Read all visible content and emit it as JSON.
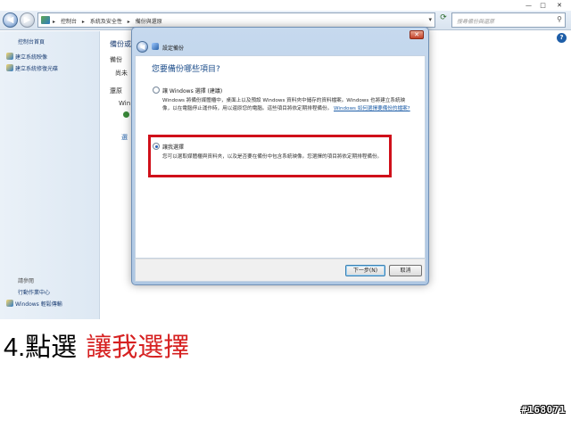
{
  "explorer": {
    "breadcrumbs": [
      "控制台",
      "系統及安全性",
      "備份與還原"
    ],
    "search_placeholder": "搜尋備份與還原",
    "window_controls": {
      "minimize": "—",
      "maximize": "□",
      "close": "✕"
    },
    "help_label": "?"
  },
  "sidebar": {
    "home": "控制台首頁",
    "items": [
      {
        "label": "建立系統映像",
        "icon": "shield-icon"
      },
      {
        "label": "建立系統修復光碟",
        "icon": "shield-icon"
      }
    ],
    "see_also": "請參閱",
    "bottom_items": [
      {
        "label": "行動作業中心"
      },
      {
        "label": "Windows 輕鬆傳輸",
        "icon": "transfer-icon"
      }
    ]
  },
  "background_main": {
    "title_fragment": "備份或",
    "label1": "備份",
    "label2": "尚未",
    "restore_label": "還原",
    "win_fragment": "Win",
    "link_fragment": "選"
  },
  "dialog": {
    "caption": "設定備份",
    "question": "您要備份哪些項目?",
    "option1": {
      "label": "讓 Windows 選擇 (建議)",
      "desc": "Windows 將備份媒體櫃中，桌面上以及預設 Windows 資料夾中儲存的資料檔案。Windows 也將建立系統映像，以在電腦停止運作時，用以還原您的電腦。這些項目將依定期排程備份。",
      "link": "Windows 如何選擇要備份的檔案?",
      "selected": false
    },
    "option2": {
      "label": "讓我選擇",
      "desc": "您可以選取媒體櫃與資料夾，以及是否要在備份中包含系統映像。您選擇的項目將依定期排程備份。",
      "selected": true
    },
    "next_button": "下一步(N)",
    "cancel_button": "取消",
    "close_label": "✕"
  },
  "caption": {
    "number": "4.點選",
    "highlight": "讓我選擇",
    "color_highlight": "#d62020"
  },
  "watermark": "#168071"
}
